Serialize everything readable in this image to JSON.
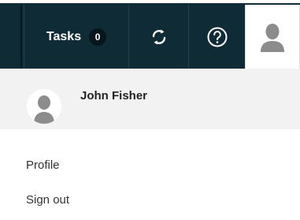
{
  "topbar": {
    "tasks_label": "Tasks",
    "tasks_count": "0",
    "sync_icon": "sync-icon",
    "help_icon": "help-icon",
    "avatar_icon": "user-avatar-icon"
  },
  "user_menu": {
    "name": "John Fisher",
    "items": [
      {
        "label": "Profile"
      },
      {
        "label": "Sign out"
      }
    ]
  },
  "colors": {
    "topbar_bg": "#0f2b36",
    "menu_header_bg": "#f2f2f2",
    "avatar_gray": "#8c8c8c"
  }
}
